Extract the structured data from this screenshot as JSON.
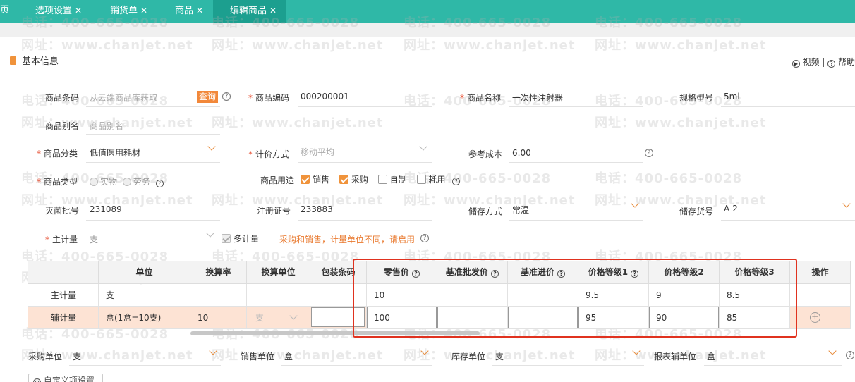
{
  "tabs": [
    {
      "label": "页",
      "closable": false
    },
    {
      "label": "选项设置",
      "closable": true
    },
    {
      "label": "销货单",
      "closable": true
    },
    {
      "label": "商品",
      "closable": true
    },
    {
      "label": "编辑商品",
      "closable": true,
      "active": true
    }
  ],
  "watermark": {
    "phone": "电话：400-665-0028",
    "site": "网址：www.chanjet.net"
  },
  "section": {
    "title": "基本信息"
  },
  "help": {
    "video": "视频",
    "sep": "|",
    "help": "帮助"
  },
  "form": {
    "barcode": {
      "label": "商品条码",
      "placeholder": "从云端商品库获取",
      "query_btn": "查询"
    },
    "code": {
      "label": "商品编码",
      "value": "000200001"
    },
    "name": {
      "label": "商品名称",
      "value": "一次性注射器"
    },
    "spec": {
      "label": "规格型号",
      "value": "5ml"
    },
    "alias": {
      "label": "商品别名",
      "placeholder": "商品别名"
    },
    "category": {
      "label": "商品分类",
      "value": "低值医用耗材"
    },
    "valuation": {
      "label": "计价方式",
      "value": "移动平均"
    },
    "ref_cost": {
      "label": "参考成本",
      "value": "6.00"
    },
    "type": {
      "label": "商品类型",
      "options": [
        "实物",
        "劳务"
      ]
    },
    "usage": {
      "label": "商品用途",
      "options": [
        {
          "label": "销售",
          "checked": true
        },
        {
          "label": "采购",
          "checked": true
        },
        {
          "label": "自制",
          "checked": false
        },
        {
          "label": "耗用",
          "checked": false
        }
      ]
    },
    "sterile_batch": {
      "label": "灭菌批号",
      "value": "231089"
    },
    "reg_no": {
      "label": "注册证号",
      "value": "233883"
    },
    "storage": {
      "label": "储存方式",
      "value": "常温"
    },
    "location": {
      "label": "储存货号",
      "value": "A-2"
    },
    "main_unit": {
      "label": "主计量",
      "value": "支"
    },
    "multi_unit": {
      "label": "多计量",
      "checked": true
    },
    "multi_hint": "采购和销售，计量单位不同，请启用"
  },
  "table": {
    "headers": [
      "单位",
      "换算率",
      "换算单位",
      "包装条码",
      "零售价",
      "基准批发价",
      "基准进价",
      "价格等级1",
      "价格等级2",
      "价格等级3",
      "操作"
    ],
    "rows": [
      {
        "kind": "主计量",
        "unit": "支",
        "rate": "",
        "conv_unit": "",
        "barcode": "",
        "retail": "10",
        "wholesale": "",
        "purchase": "",
        "p1": "9.5",
        "p2": "9",
        "p3": "8.5"
      },
      {
        "kind": "辅计量",
        "unit": "盒(1盒=10支)",
        "rate": "10",
        "conv_unit": "支",
        "barcode": "",
        "retail": "100",
        "wholesale": "",
        "purchase": "",
        "p1": "95",
        "p2": "90",
        "p3": "85"
      }
    ]
  },
  "units": {
    "purchase": {
      "label": "采购单位",
      "value": "支"
    },
    "sales": {
      "label": "销售单位",
      "value": "盒"
    },
    "stock": {
      "label": "库存单位",
      "value": "支"
    },
    "report": {
      "label": "报表辅单位",
      "value": "盒"
    }
  },
  "custom_btn": "自定义项设置",
  "colors": {
    "tabbar": "#2fb8a7",
    "accent": "#f0933b",
    "required": "#e64b2e",
    "highlight_row": "#fde3d4",
    "red_frame": "#e0321f"
  }
}
